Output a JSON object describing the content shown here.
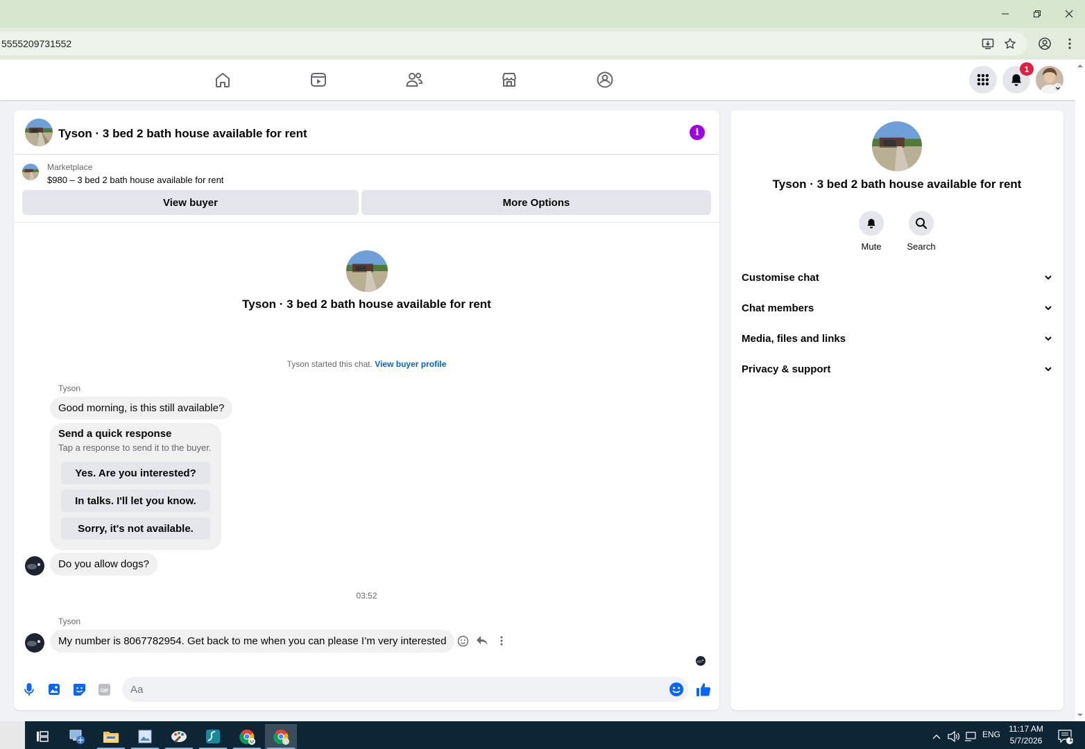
{
  "browser": {
    "url": "5555209731552"
  },
  "nav": {
    "notification_count": "1"
  },
  "chat": {
    "header_title": "Tyson · 3 bed 2 bath house available for rent",
    "marketplace_label": "Marketplace",
    "listing_desc": "$980 – 3 bed 2 bath house available for rent",
    "view_buyer_label": "View buyer",
    "more_options_label": "More Options",
    "intro_name": "Tyson · 3 bed 2 bath house available for rent",
    "started_text": "Tyson started this chat.",
    "view_profile_link": "View buyer profile",
    "sender_name_1": "Tyson",
    "msg_1": "Good morning, is this still available?",
    "quick_title": "Send a quick response",
    "quick_sub": "Tap a response to send it to the buyer.",
    "quick_options": [
      "Yes. Are you interested?",
      "In talks. I'll let you know.",
      "Sorry, it's not available."
    ],
    "msg_2": "Do you allow dogs?",
    "timestamp": "03:52",
    "sender_name_2": "Tyson",
    "msg_3": "My number is 8067782954. Get back to me when you can please I’m very interested",
    "composer_placeholder": "Aa"
  },
  "info_panel": {
    "title": "Tyson · 3 bed 2 bath house available for rent",
    "mute_label": "Mute",
    "search_label": "Search",
    "rows": [
      "Customise chat",
      "Chat members",
      "Media, files and links",
      "Privacy & support"
    ]
  },
  "taskbar": {
    "lang": "ENG",
    "time": "11:17 AM",
    "date": "5/7/2026",
    "notif_count": "12"
  },
  "colors": {
    "fb_blue": "#0866ff",
    "link_blue": "#0064d1",
    "info_purple": "#a100e0",
    "badge_red": "#e41e3f"
  }
}
